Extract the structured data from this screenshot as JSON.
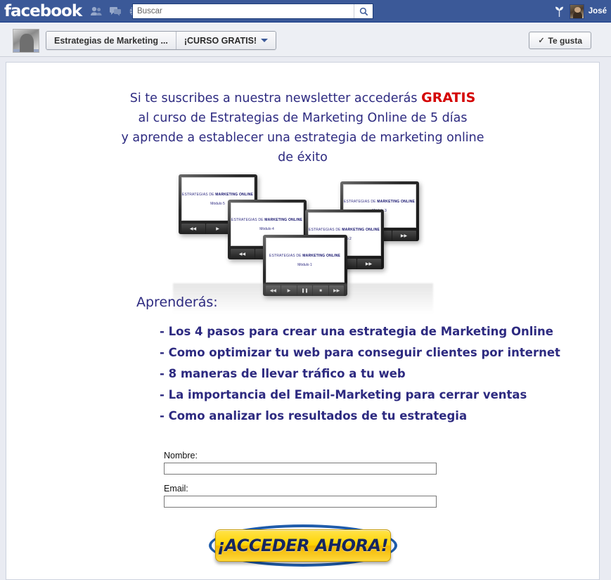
{
  "topbar": {
    "logo": "facebook",
    "nav_icons": [
      "friends-icon",
      "messages-icon",
      "globe-icon"
    ],
    "search": {
      "value": "",
      "placeholder": "Buscar"
    },
    "search_button_icon": "search-icon",
    "plant_icon": "plant-icon",
    "user_name": "José",
    "avatar": "user-avatar"
  },
  "page_bar": {
    "page_avatar": "page-avatar",
    "tabs": [
      {
        "label": "Estrategias de Marketing ...",
        "has_caret": false
      },
      {
        "label": "¡CURSO GRATIS!",
        "has_caret": true
      }
    ],
    "like_button": {
      "check": "✓",
      "label": "Te gusta"
    }
  },
  "content": {
    "headline": {
      "line1_a": "Si te suscribes a nuestra newsletter accederás ",
      "line1_b": "GRATIS",
      "line2": "al curso de Estrategias de Marketing Online de 5 días",
      "line3": "y aprende a establecer una estrategia de marketing online",
      "line4": "de éxito"
    },
    "devices": {
      "screen_title_light": "ESTRATEGIAS DE ",
      "screen_title_bold": "MARKETING ONLINE",
      "modules": [
        "Módulo 1",
        "Módulo 2",
        "Módulo 3",
        "Módulo 4",
        "Módulo 5"
      ],
      "control_glyphs": [
        "◀◀",
        "▶",
        "❚❚",
        "■",
        "▶▶"
      ]
    },
    "learn_heading": "Aprenderás:",
    "bullets": [
      "- Los 4 pasos para crear una estrategia de Marketing Online",
      "- Como optimizar tu web para conseguir clientes por internet",
      "- 8 maneras de llevar tráfico a tu web",
      "- La importancia del Email-Marketing para cerrar ventas",
      "- Como analizar los resultados de tu estrategia"
    ],
    "form": {
      "name_label": "Nombre:",
      "name_value": "",
      "email_label": "Email:",
      "email_value": ""
    },
    "cta_label": "¡ACCEDER AHORA!"
  },
  "colors": {
    "facebook_blue": "#3b5998",
    "headline_navy": "#2d2a80",
    "gratis_red": "#d40000",
    "cta_yellow": "#ffd400",
    "cta_ring_blue": "#1f5cab"
  }
}
